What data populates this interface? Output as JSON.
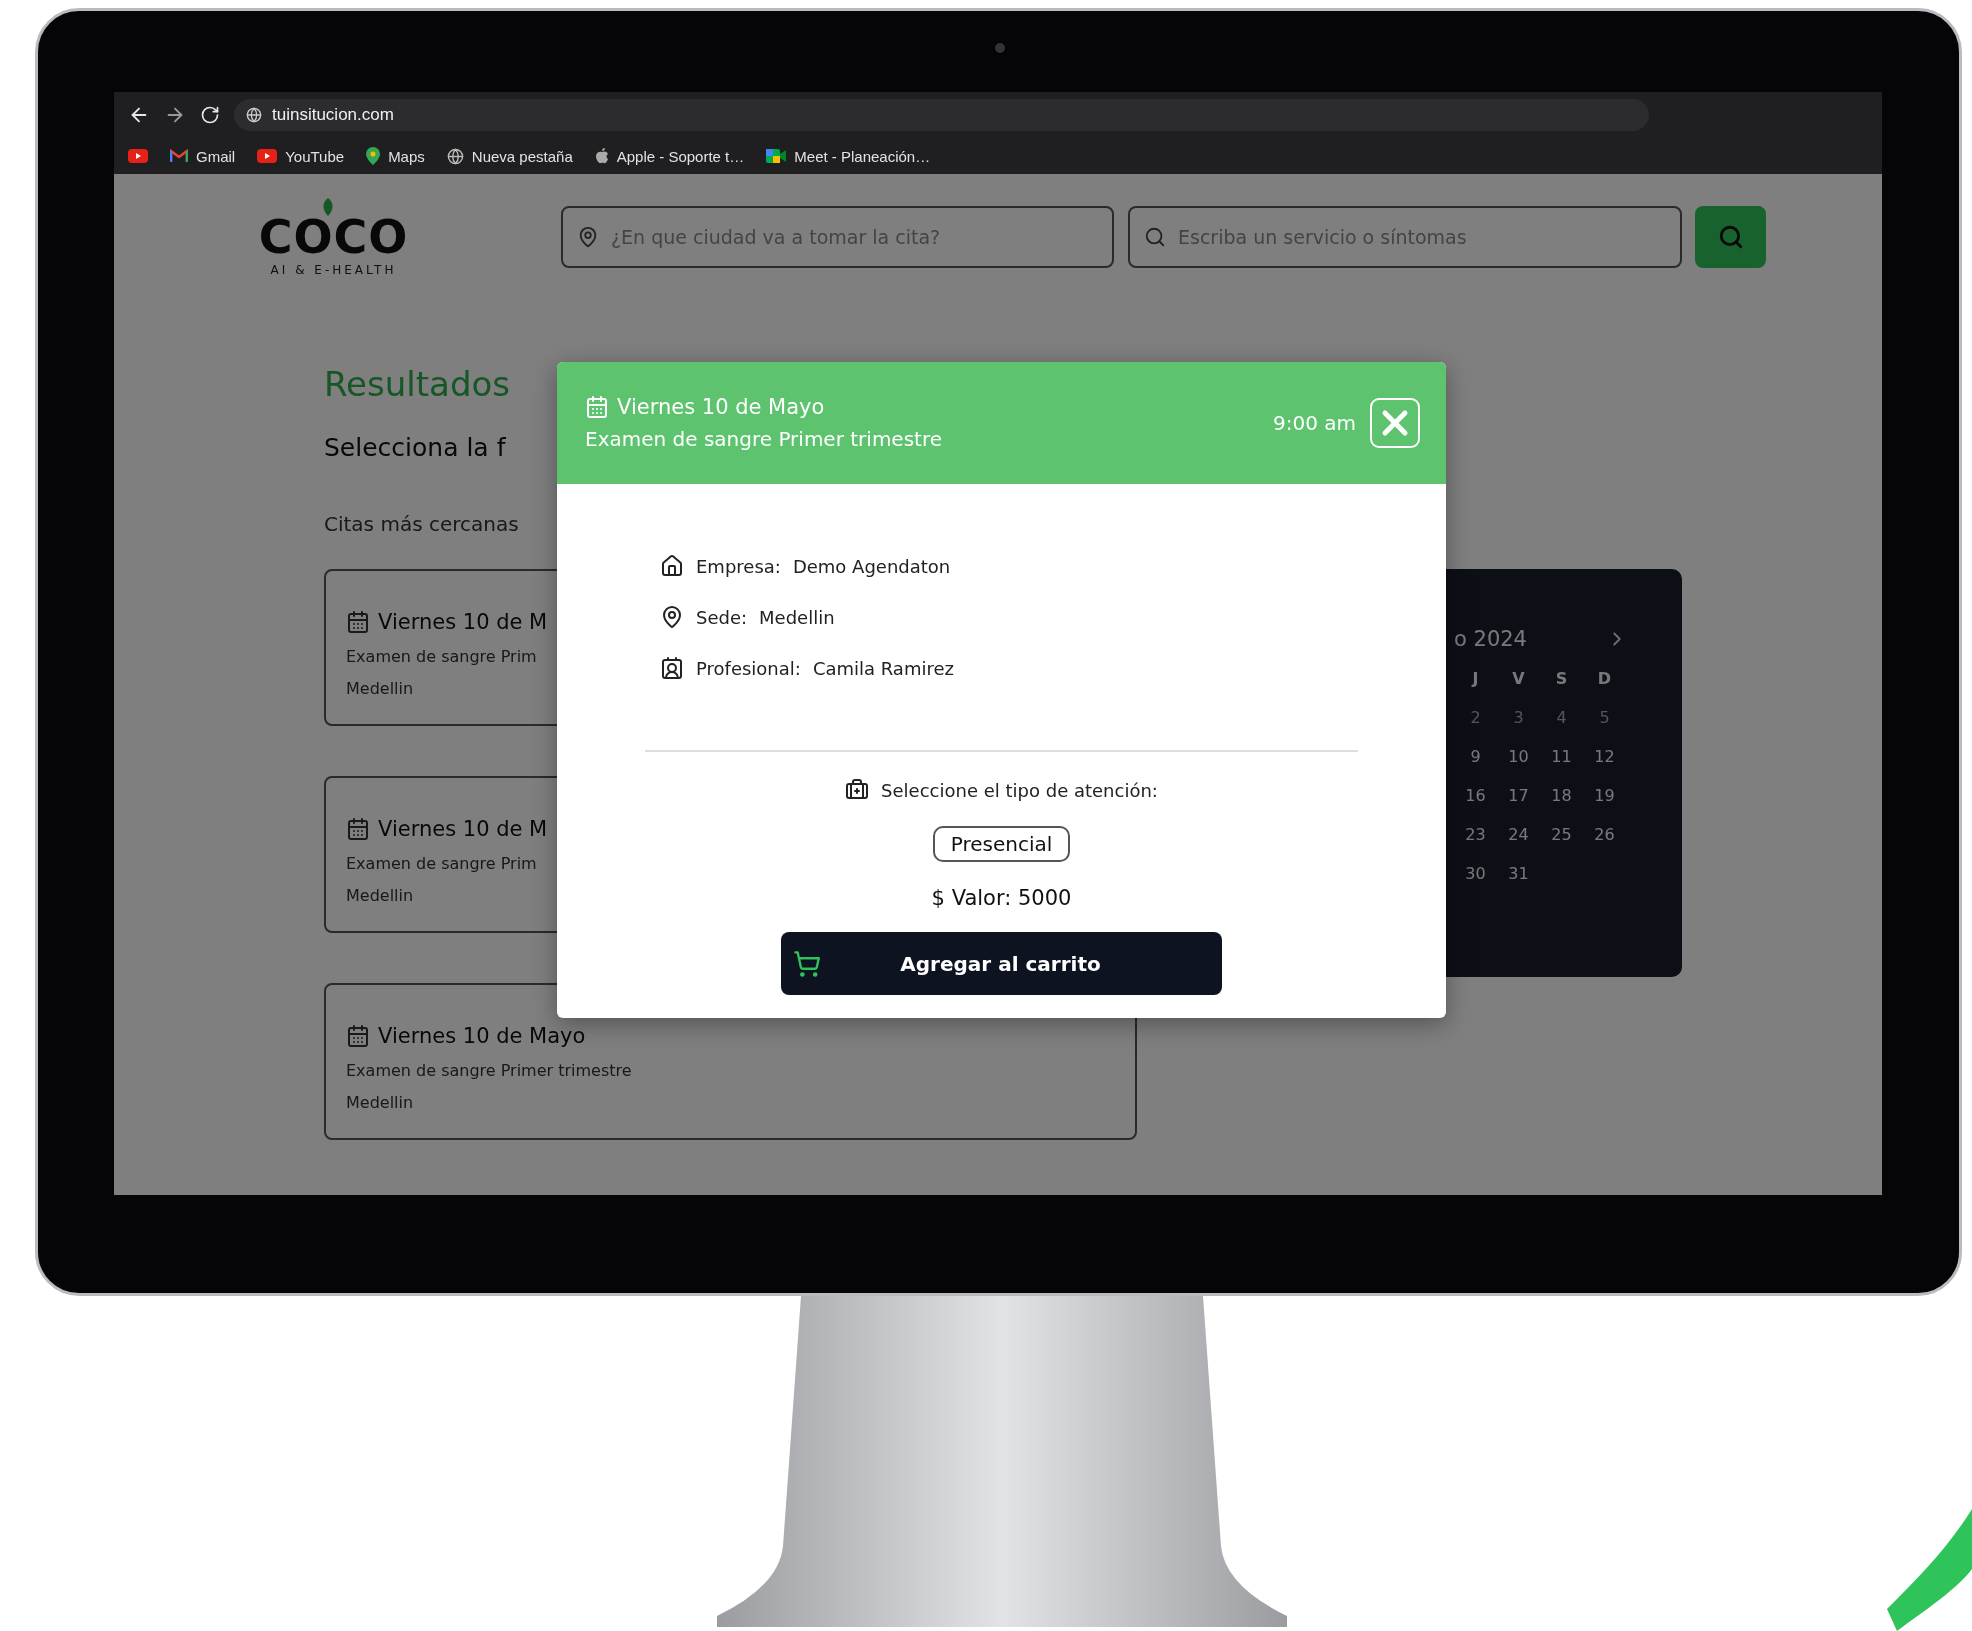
{
  "browser": {
    "url": "tuinsitucion.com",
    "bookmarks": [
      {
        "kind": "youtube"
      },
      {
        "kind": "gmail",
        "label": "Gmail"
      },
      {
        "kind": "youtube",
        "label": "YouTube"
      },
      {
        "kind": "maps",
        "label": "Maps"
      },
      {
        "kind": "globe",
        "label": "Nueva pestaña"
      },
      {
        "kind": "apple",
        "label": "Apple - Soporte t…"
      },
      {
        "kind": "meet",
        "label": "Meet - Planeación…"
      }
    ]
  },
  "header": {
    "logo": {
      "name": "COCO",
      "tagline": "AI & E-HEALTH"
    },
    "city_field": {
      "placeholder": "¿En que ciudad va a tomar la cita?"
    },
    "service_field": {
      "placeholder": "Escriba un servicio o síntomas"
    }
  },
  "results": {
    "title": "Resultados",
    "subtitle": "Selecciona la f",
    "nearest_label": "Citas más cercanas",
    "cards": [
      {
        "date": "Viernes 10 de M",
        "service": "Examen de sangre Prim",
        "location": "Medellin"
      },
      {
        "date": "Viernes 10 de M",
        "service": "Examen de sangre Prim",
        "location": "Medellin"
      },
      {
        "date": "Viernes 10 de Mayo",
        "service": "Examen de sangre Primer trimestre",
        "location": "Medellin"
      }
    ]
  },
  "calendar": {
    "month_label": "o 2024",
    "weekdays": [
      "J",
      "V",
      "S",
      "D"
    ],
    "weeks": [
      [
        {
          "day": "2",
          "disabled": true
        },
        {
          "day": "3",
          "disabled": true
        },
        {
          "day": "4",
          "disabled": true
        },
        {
          "day": "5",
          "disabled": true
        }
      ],
      [
        {
          "day": "9",
          "disabled": false
        },
        {
          "day": "10",
          "disabled": false
        },
        {
          "day": "11",
          "disabled": false
        },
        {
          "day": "12",
          "disabled": false
        }
      ],
      [
        {
          "day": "16",
          "disabled": false
        },
        {
          "day": "17",
          "disabled": false
        },
        {
          "day": "18",
          "disabled": false
        },
        {
          "day": "19",
          "disabled": false
        }
      ],
      [
        {
          "day": "23",
          "disabled": false
        },
        {
          "day": "24",
          "disabled": false
        },
        {
          "day": "25",
          "disabled": false
        },
        {
          "day": "26",
          "disabled": false
        }
      ],
      [
        {
          "day": "30",
          "disabled": false
        },
        {
          "day": "31",
          "disabled": false
        }
      ]
    ]
  },
  "modal": {
    "date": "Viernes 10 de Mayo",
    "service": "Examen de sangre Primer trimestre",
    "time": "9:00 am",
    "details": [
      {
        "kind": "company",
        "label": "Empresa:",
        "value": "Demo Agendaton"
      },
      {
        "kind": "location",
        "label": "Sede:",
        "value": "Medellin"
      },
      {
        "kind": "professional",
        "label": "Profesional:",
        "value": "Camila Ramirez"
      }
    ],
    "attention_prompt": "Seleccione el tipo de atención:",
    "attention_option": "Presencial",
    "price": "$ Valor: 5000",
    "cart_button": "Agregar al carrito"
  }
}
